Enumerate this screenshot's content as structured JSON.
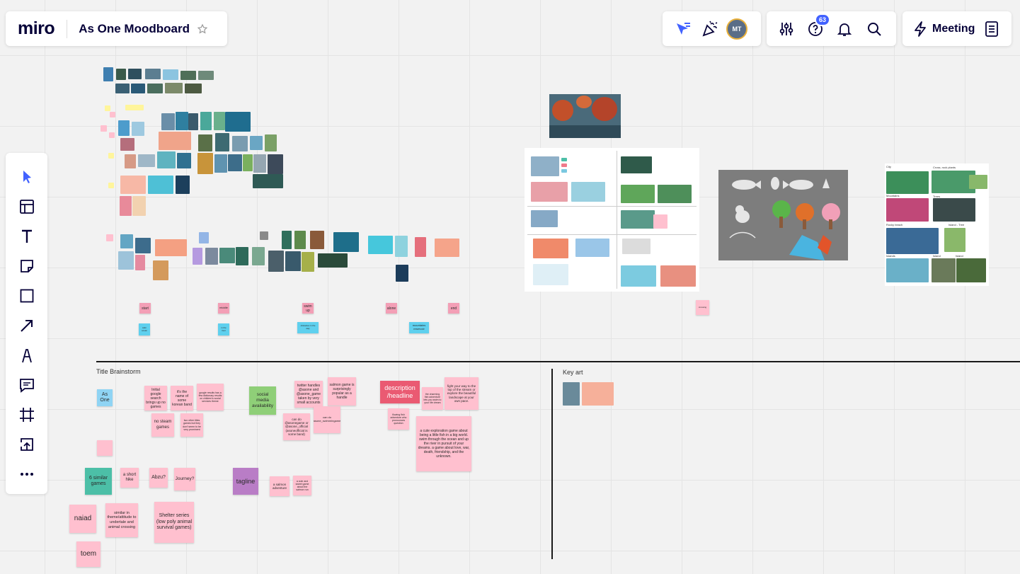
{
  "header": {
    "logo": "miro",
    "board_title": "As One Moodboard",
    "avatar_initials": "MT",
    "help_badge": "63",
    "meeting_label": "Meeting"
  },
  "toolbar": {
    "icons": [
      "select-cursor-icon",
      "templates-icon",
      "text-icon",
      "sticky-note-icon",
      "shape-icon",
      "arrow-icon",
      "pen-icon",
      "comment-icon",
      "frame-icon",
      "upload-icon",
      "more-icon"
    ]
  },
  "frames": {
    "title_brainstorm": "Title Brainstorm",
    "key_art": "Key art"
  },
  "journey_notes": {
    "top": [
      "start",
      "middle",
      "swim up",
      "alone",
      "end"
    ],
    "bottom": [
      "calm ocean",
      "in the river",
      "obstacles in the way",
      "mountains reservoir"
    ],
    "right_note": "crossing"
  },
  "brainstorm_notes": {
    "as_one": "As One",
    "initial_google": "Initial google search brings up no games",
    "name_band": "it's the name of some korean band",
    "google_results": "google results has a few dictionary results on children's social services theme",
    "no_steam": "no steam games",
    "other_titles": "two other titles games but they don't seem to be very prominent",
    "social_media": "social media availability",
    "twitter_handles": "twitter handles @asone and @asone_game taken by very small accounts",
    "salmon_popular": "salmon game is surprisingly popular as a handle",
    "asonegame": "can do @asonegame or @asone_official (asoneofficial is some band)",
    "asone_swimgame": "can do asone_swimmingame",
    "description": "description /headline",
    "fish_adventure": "the charming fish adventure lets you swim to your life dream",
    "flowing_fish": "flowing fish adventure who pronounces question",
    "fight_your_way": "fight your way to the top of the stream or explore the beautiful landscape at your own pace.",
    "cute_exploration": "a cute exploration game about being a little fish in a big world. swim through the ocean and up the river in pursuit of your dreams. a game about love, war, death, friendship, and the unknown.",
    "similar_games": "6 similar games",
    "short_hike": "a short hike",
    "abzu": "Abzu?",
    "journey": "Journey?",
    "tagline": "tagline",
    "salmon_adventure": "a salmon adventure",
    "cute_sweet": "a cute and sweet game about the salmon run",
    "naiad": "naiad",
    "similar_theme": "similar in theme/attitude to undertale and animal crossing",
    "shelter": "Shelter series (low poly animal survival games)",
    "toem": "toem"
  },
  "swatches": {
    "pink": "#ffc0cf",
    "blue": "#8fd4f4",
    "green": "#8fcf78",
    "teal": "#4cbfa7",
    "purple": "#b97dc6",
    "red": "#ea5a72",
    "accent": "#4262ff"
  },
  "style_board": {
    "headers": [
      "City",
      "Cross, rock plants",
      "Mountains",
      "Trees",
      "Rocky beach",
      "Island - Tree",
      "Islands",
      "Island",
      "Island"
    ]
  }
}
